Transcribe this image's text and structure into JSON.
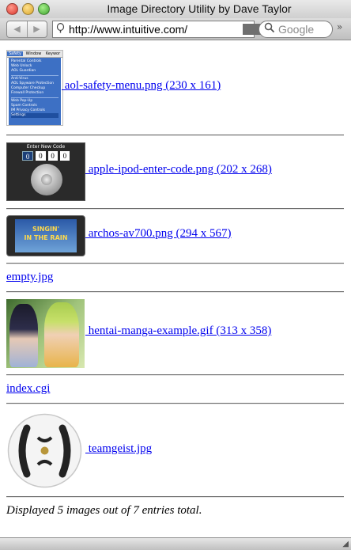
{
  "window": {
    "title": "Image Directory Utility by Dave Taylor"
  },
  "toolbar": {
    "back_label": "◀",
    "forward_label": "▶",
    "url": "http://www.intuitive.com/",
    "search_placeholder": "Google"
  },
  "aol_thumb": {
    "items": [
      "Safety",
      "Window",
      "Keywor",
      "Parental Controls",
      "Web Unlock",
      "AOL Guardian",
      "Anti-Virus",
      "AOL Spyware Protection",
      "Computer Checkup",
      "Firewall Protection",
      "Web Pop-Up",
      "Spam Controls",
      "IM Privacy Controls",
      "Settings"
    ]
  },
  "ipod_thumb": {
    "title": "Enter New Code",
    "digits": [
      "0",
      "0",
      "0",
      "0"
    ]
  },
  "archos_thumb": {
    "caption_line1": "SINGIN'",
    "caption_line2": "IN THE RAIN"
  },
  "entries": [
    {
      "link": " aol-safety-menu.png (230 x 161)"
    },
    {
      "link": " apple-ipod-enter-code.png (202 x 268)"
    },
    {
      "link": " archos-av700.png (294 x 567)"
    },
    {
      "link": "empty.jpg"
    },
    {
      "link": " hentai-manga-example.gif (313 x 358)"
    },
    {
      "link": "index.cgi"
    },
    {
      "link": " teamgeist.jpg"
    }
  ],
  "footer": {
    "summary": "Displayed 5 images out of 7 entries total."
  },
  "colors": {
    "link": "#0000ee",
    "accent": "#3d70c4"
  }
}
